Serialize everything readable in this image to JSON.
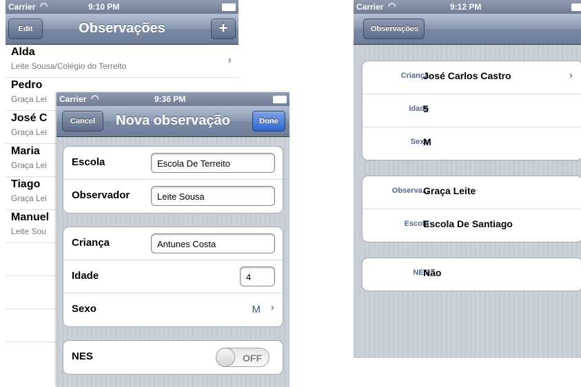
{
  "left_screen": {
    "status": {
      "carrier": "Carrier",
      "time": "9:10 PM"
    },
    "nav": {
      "edit": "Edit",
      "title": "Observações",
      "add": "+"
    },
    "rows": [
      {
        "title": "Alda",
        "subtitle": "Leite Sousa/Colégio do Terreito"
      },
      {
        "title": "Pedro",
        "subtitle": "Graça Lei"
      },
      {
        "title": "José C",
        "subtitle": "Graça Lei"
      },
      {
        "title": "Maria",
        "subtitle": "Graça Lei"
      },
      {
        "title": "Tiago",
        "subtitle": "Graça Lei"
      },
      {
        "title": "Manuel",
        "subtitle": "Leite Sou"
      }
    ]
  },
  "modal_screen": {
    "status": {
      "carrier": "Carrier",
      "time": "9:36 PM"
    },
    "nav": {
      "cancel": "Cancel",
      "title": "Nova observação",
      "done": "Done"
    },
    "section1": [
      {
        "label": "Escola",
        "value": "Escola De Terreito"
      },
      {
        "label": "Observador",
        "value": "Leite Sousa"
      }
    ],
    "section2": {
      "crianca_label": "Criança",
      "crianca_value": "Antunes Costa",
      "idade_label": "Idade",
      "idade_value": "4",
      "sexo_label": "Sexo",
      "sexo_value": "M"
    },
    "section3": {
      "nes_label": "NES",
      "nes_toggle": "OFF"
    }
  },
  "right_screen": {
    "status": {
      "carrier": "Carrier",
      "time": "9:12 PM"
    },
    "nav": {
      "back": "Observações"
    },
    "group1": [
      {
        "label": "Criança",
        "value": "José Carlos Castro"
      },
      {
        "label": "Idade",
        "value": "5"
      },
      {
        "label": "Sexo",
        "value": "M"
      }
    ],
    "group2": [
      {
        "label": "Observa...",
        "value": "Graça Leite"
      },
      {
        "label": "Escola",
        "value": "Escola De Santiago"
      }
    ],
    "group3": [
      {
        "label": "NES",
        "value": "Não"
      }
    ]
  }
}
